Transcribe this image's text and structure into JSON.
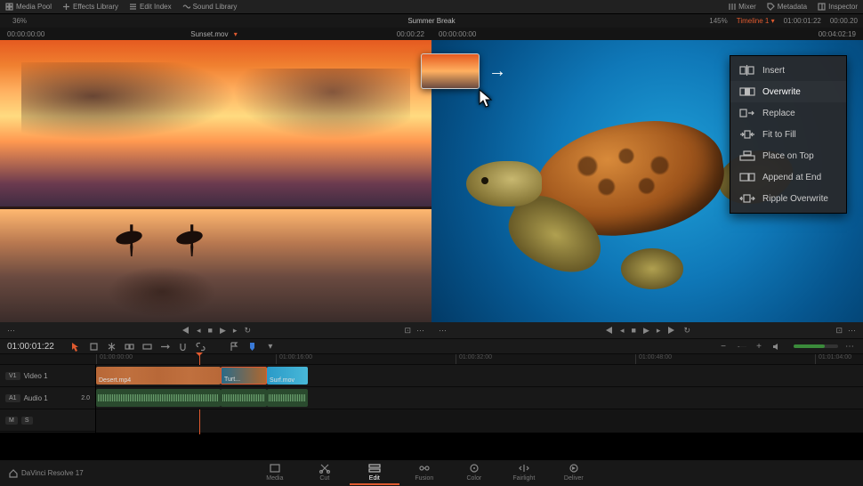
{
  "app": {
    "project_title": "Summer Break",
    "brand": "DaVinci Resolve 17"
  },
  "menubar": {
    "left": [
      {
        "label": "Media Pool"
      },
      {
        "label": "Effects Library"
      },
      {
        "label": "Edit Index"
      },
      {
        "label": "Sound Library"
      }
    ],
    "right": [
      {
        "label": "Mixer"
      },
      {
        "label": "Metadata"
      },
      {
        "label": "Inspector"
      }
    ]
  },
  "infobar": {
    "left_pct": "36%",
    "right_pct": "145%",
    "timeline_label": "Timeline 1",
    "right_tc": "01:00:01:22",
    "right_dur": "00:00.20"
  },
  "source": {
    "title": "Sunset.mov",
    "tc_left": "00:00:00:00",
    "tc_right": "00:00:22"
  },
  "program": {
    "tc_left": "00:00:00:00",
    "tc_right": "00:04:02:19"
  },
  "ctx": {
    "items": [
      "Insert",
      "Overwrite",
      "Replace",
      "Fit to Fill",
      "Place on Top",
      "Append at End",
      "Ripple Overwrite"
    ],
    "active_index": 1
  },
  "editbar": {
    "timecode": "01:00:01:22"
  },
  "ruler": {
    "ticks": [
      "01:00:00:00",
      "01:00:16:00",
      "01:00:32:00",
      "01:00:48:00",
      "01:01:04:00"
    ]
  },
  "tracks": {
    "video": {
      "id": "V1",
      "name": "Video 1"
    },
    "audio": {
      "id": "A1",
      "name": "Audio 1",
      "ch": "2.0"
    }
  },
  "clips": {
    "v": [
      {
        "name": "Desert.mp4"
      },
      {
        "name": "Turt..."
      },
      {
        "name": "Surf.mov"
      }
    ]
  },
  "pages": [
    "Media",
    "Cut",
    "Edit",
    "Fusion",
    "Color",
    "Fairlight",
    "Deliver"
  ],
  "active_page_index": 2,
  "colors": {
    "accent": "#e05a2f"
  }
}
